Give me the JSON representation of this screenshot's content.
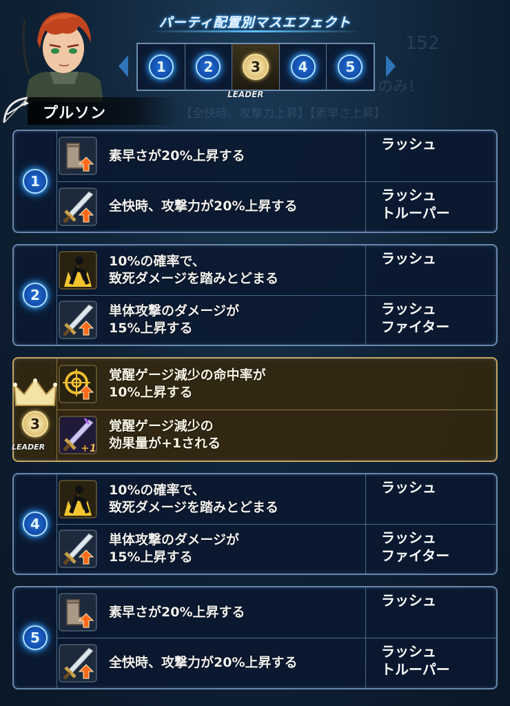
{
  "header": {
    "title": "パーティ配置別マスエフェクト",
    "character_name": "プルソン",
    "leader_label": "LEADER",
    "active_slot": 3,
    "slots": [
      "1",
      "2",
      "3",
      "4",
      "5"
    ],
    "background_ghost_text": [
      "152",
      "のみ！",
      "【全快時、攻撃力上昇】【素早さ上昇】"
    ]
  },
  "colors": {
    "accent_blue": "#1e7de0",
    "leader_gold": "#c9a861",
    "panel_border": "#6a88ad"
  },
  "panels": [
    {
      "badge": "1",
      "rows": [
        {
          "icon": "boot-speed-up-icon",
          "effect": "素早さが20%上昇する",
          "classes": "ラッシュ"
        },
        {
          "icon": "sword-attack-up-icon",
          "effect": "全快時、攻撃力が20%上昇する",
          "classes": "ラッシュ\nトルーパー"
        }
      ]
    },
    {
      "badge": "2",
      "rows": [
        {
          "icon": "endure-icon",
          "effect": "10%の確率で、\n致死ダメージを踏みとどまる",
          "classes": "ラッシュ"
        },
        {
          "icon": "sword-attack-up-icon",
          "effect": "単体攻撃のダメージが\n15%上昇する",
          "classes": "ラッシュ\nファイター"
        }
      ]
    },
    {
      "badge": "3",
      "leader": true,
      "badge_label": "LEADER",
      "rows": [
        {
          "icon": "crosshair-up-icon",
          "effect": "覚醒ゲージ減少の命中率が\n10%上昇する",
          "classes": ""
        },
        {
          "icon": "sword-plus-one-icon",
          "effect": "覚醒ゲージ減少の\n効果量が+1される",
          "classes": ""
        }
      ]
    },
    {
      "badge": "4",
      "rows": [
        {
          "icon": "endure-icon",
          "effect": "10%の確率で、\n致死ダメージを踏みとどまる",
          "classes": "ラッシュ"
        },
        {
          "icon": "sword-attack-up-icon",
          "effect": "単体攻撃のダメージが\n15%上昇する",
          "classes": "ラッシュ\nファイター"
        }
      ]
    },
    {
      "badge": "5",
      "rows": [
        {
          "icon": "boot-speed-up-icon",
          "effect": "素早さが20%上昇する",
          "classes": "ラッシュ"
        },
        {
          "icon": "sword-attack-up-icon",
          "effect": "全快時、攻撃力が20%上昇する",
          "classes": "ラッシュ\nトルーパー"
        }
      ]
    }
  ]
}
